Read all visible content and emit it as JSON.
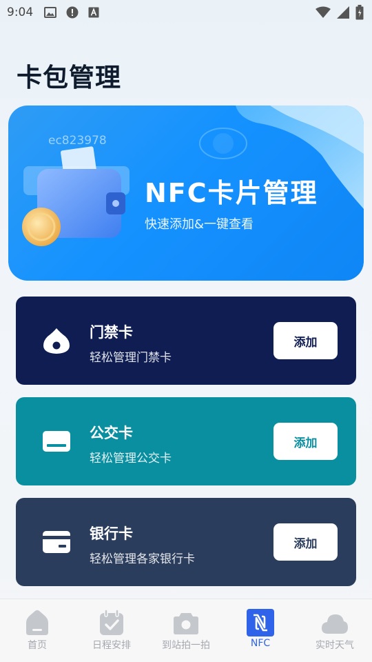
{
  "status_bar": {
    "time": "9:04"
  },
  "page": {
    "title": "卡包管理"
  },
  "banner": {
    "code": "ec823978",
    "title": "NFC卡片管理",
    "subtitle": "快速添加&一键查看"
  },
  "cards": [
    {
      "title": "门禁卡",
      "subtitle": "轻松管理门禁卡",
      "button": "添加",
      "icon": "access-tag-icon",
      "color": "#0f1d52",
      "button_color": "#0f1d52"
    },
    {
      "title": "公交卡",
      "subtitle": "轻松管理公交卡",
      "button": "添加",
      "icon": "bus-card-icon",
      "color": "#0a8fa0",
      "button_color": "#0a8fa0"
    },
    {
      "title": "银行卡",
      "subtitle": "轻松管理各家银行卡",
      "button": "添加",
      "icon": "bank-card-icon",
      "color": "#2b3d5c",
      "button_color": "#2b3d5c"
    }
  ],
  "tabbar": {
    "items": [
      {
        "label": "首页",
        "icon": "home-icon",
        "active": false
      },
      {
        "label": "日程安排",
        "icon": "calendar-check-icon",
        "active": false
      },
      {
        "label": "到站拍一拍",
        "icon": "camera-icon",
        "active": false
      },
      {
        "label": "NFC",
        "icon": "nfc-icon",
        "active": true
      },
      {
        "label": "实时天气",
        "icon": "cloud-icon",
        "active": false
      }
    ]
  }
}
